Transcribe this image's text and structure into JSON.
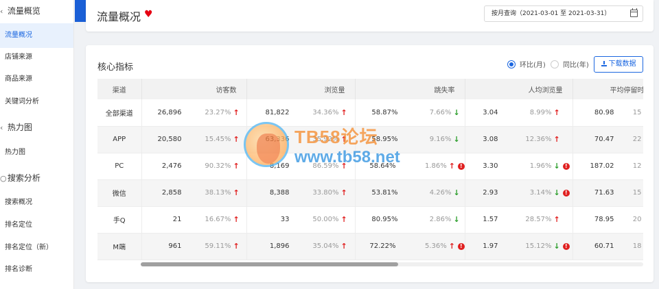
{
  "sidebar": {
    "groups": [
      {
        "label": "流量概览",
        "icon": "chevron-icon"
      },
      {
        "label": "热力图",
        "icon": "chevron-icon"
      },
      {
        "label": "搜索分析",
        "icon": "search-icon"
      }
    ],
    "items": [
      {
        "label": "流量概况",
        "active": true
      },
      {
        "label": "店铺来源"
      },
      {
        "label": "商品来源"
      },
      {
        "label": "关键词分析"
      },
      {
        "label": "热力图"
      },
      {
        "label": "搜索概况"
      },
      {
        "label": "排名定位"
      },
      {
        "label": "排名定位（新）"
      },
      {
        "label": "排名诊断"
      }
    ]
  },
  "header": {
    "title": "流量概况",
    "date_range": "按月查询（2021-03-01 至 2021-03-31）"
  },
  "main": {
    "title": "核心指标",
    "radio_mom": "环比(月)",
    "radio_yoy": "同比(年)",
    "download_label": "下载数据",
    "columns": [
      "渠道",
      "访客数",
      "浏览量",
      "跳失率",
      "人均浏览量",
      "平均停留时"
    ],
    "rows": [
      {
        "channel": "全部渠道",
        "visitors": "26,896",
        "visitors_pct": "23.27%",
        "pv": "81,822",
        "pv_pct": "34.36%",
        "bounce": "58.87%",
        "bounce_pct": "7.66%",
        "avg_pv": "3.04",
        "avg_pv_pct": "8.99%",
        "stay": "80.98",
        "stay_pct": "15"
      },
      {
        "channel": "APP",
        "visitors": "20,580",
        "visitors_pct": "15.45%",
        "pv": "63,336",
        "pv_pct": "35.92%",
        "bounce": "58.95%",
        "bounce_pct": "9.16%",
        "avg_pv": "3.08",
        "avg_pv_pct": "12.36%",
        "stay": "70.47",
        "stay_pct": "22"
      },
      {
        "channel": "PC",
        "visitors": "2,476",
        "visitors_pct": "90.32%",
        "pv": "8,169",
        "pv_pct": "86.59%",
        "bounce": "58.64%",
        "bounce_pct": "1.86%",
        "avg_pv": "3.30",
        "avg_pv_pct": "1.96%",
        "stay": "187.02",
        "stay_pct": "12"
      },
      {
        "channel": "微信",
        "visitors": "2,858",
        "visitors_pct": "38.13%",
        "pv": "8,388",
        "pv_pct": "33.80%",
        "bounce": "53.81%",
        "bounce_pct": "4.26%",
        "avg_pv": "2.93",
        "avg_pv_pct": "3.14%",
        "stay": "71.63",
        "stay_pct": "15"
      },
      {
        "channel": "手Q",
        "visitors": "21",
        "visitors_pct": "16.67%",
        "pv": "33",
        "pv_pct": "50.00%",
        "bounce": "80.95%",
        "bounce_pct": "2.86%",
        "avg_pv": "1.57",
        "avg_pv_pct": "28.57%",
        "stay": "78.95",
        "stay_pct": "20"
      },
      {
        "channel": "M端",
        "visitors": "961",
        "visitors_pct": "59.11%",
        "pv": "1,896",
        "pv_pct": "35.04%",
        "bounce": "72.22%",
        "bounce_pct": "5.36%",
        "avg_pv": "1.97",
        "avg_pv_pct": "15.12%",
        "stay": "60.71",
        "stay_pct": "18"
      }
    ]
  },
  "watermark": {
    "title": "TB58论坛",
    "url": "www.tb58.net"
  }
}
